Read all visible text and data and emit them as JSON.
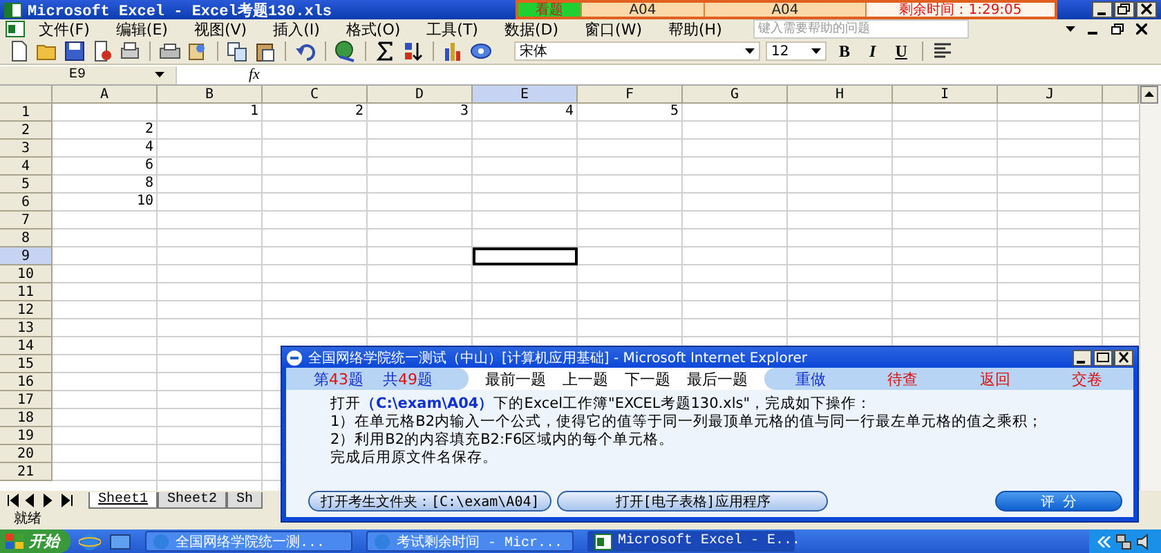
{
  "window": {
    "title": "Microsoft Excel - Excel考题130.xls"
  },
  "exam_timer": {
    "view_button": "看题",
    "field_1": "A04",
    "field_2": "A04",
    "time_left": "剩余时间：1:29:05"
  },
  "menu": [
    "文件(F)",
    "编辑(E)",
    "视图(V)",
    "插入(I)",
    "格式(O)",
    "工具(T)",
    "数据(D)",
    "窗口(W)",
    "帮助(H)"
  ],
  "help_search": {
    "placeholder": "键入需要帮助的问题"
  },
  "format_toolbar": {
    "font": "宋体",
    "size": "12",
    "bold": "B",
    "italic": "I",
    "underline": "U"
  },
  "formula_bar": {
    "name_box": "E9",
    "fx": "fx"
  },
  "sheet": {
    "columns": [
      {
        "label": "A",
        "selected": false
      },
      {
        "label": "B",
        "selected": false
      },
      {
        "label": "C",
        "selected": false
      },
      {
        "label": "D",
        "selected": false
      },
      {
        "label": "E",
        "selected": true
      },
      {
        "label": "F",
        "selected": false
      },
      {
        "label": "G",
        "selected": false
      },
      {
        "label": "H",
        "selected": false
      },
      {
        "label": "I",
        "selected": false
      },
      {
        "label": "J",
        "selected": false
      }
    ],
    "rows": [
      {
        "label": "1",
        "selected": false,
        "cells": {
          "B": "1",
          "C": "2",
          "D": "3",
          "E": "4",
          "F": "5"
        }
      },
      {
        "label": "2",
        "selected": false,
        "cells": {
          "A": "2"
        }
      },
      {
        "label": "3",
        "selected": false,
        "cells": {
          "A": "4"
        }
      },
      {
        "label": "4",
        "selected": false,
        "cells": {
          "A": "6"
        }
      },
      {
        "label": "5",
        "selected": false,
        "cells": {
          "A": "8"
        }
      },
      {
        "label": "6",
        "selected": false,
        "cells": {
          "A": "10"
        }
      },
      {
        "label": "7",
        "selected": false,
        "cells": {}
      },
      {
        "label": "8",
        "selected": false,
        "cells": {}
      },
      {
        "label": "9",
        "selected": true,
        "cells": {}
      },
      {
        "label": "10",
        "selected": false,
        "cells": {}
      },
      {
        "label": "11",
        "selected": false,
        "cells": {}
      },
      {
        "label": "12",
        "selected": false,
        "cells": {}
      },
      {
        "label": "13",
        "selected": false,
        "cells": {}
      },
      {
        "label": "14",
        "selected": false,
        "cells": {}
      },
      {
        "label": "15",
        "selected": false,
        "cells": {}
      },
      {
        "label": "16",
        "selected": false,
        "cells": {}
      },
      {
        "label": "17",
        "selected": false,
        "cells": {}
      },
      {
        "label": "18",
        "selected": false,
        "cells": {}
      },
      {
        "label": "19",
        "selected": false,
        "cells": {}
      },
      {
        "label": "20",
        "selected": false,
        "cells": {}
      },
      {
        "label": "21",
        "selected": false,
        "cells": {}
      }
    ]
  },
  "sheet_tabs": [
    {
      "label": "Sheet1",
      "selected": true
    },
    {
      "label": "Sheet2",
      "selected": false
    },
    {
      "label": "Sh",
      "selected": false
    }
  ],
  "status_bar": "就绪",
  "exam_window": {
    "title": "全国网络学院统一测试（中山）[计算机应用基础] - Microsoft Internet Explorer",
    "counters": [
      {
        "prefix": "第",
        "number": "43",
        "suffix": "题"
      },
      {
        "prefix": "共",
        "number": "49",
        "suffix": "题"
      }
    ],
    "nav": [
      "最前一题",
      "上一题",
      "下一题",
      "最后一题"
    ],
    "actions": [
      {
        "label": "重做",
        "color": "#1030d0"
      },
      {
        "label": "待查",
        "color": "#e01010"
      },
      {
        "label": "返回",
        "color": "#e01010"
      },
      {
        "label": "交卷",
        "color": "#e01010"
      }
    ],
    "instructions": [
      "打开**（C:\\exam\\A04）**下的Excel工作簿\"EXCEL考题130.xls\"，完成如下操作：",
      "1）在单元格B2内输入一个公式，使得它的值等于同一列最顶单元格的值与同一行最左单元格的值之乘积；",
      "2）利用B2的内容填充B2:F6区域内的每个单元格。",
      "完成后用原文件名保存。"
    ],
    "buttons": [
      {
        "kind": "folder",
        "label": "打开考生文件夹：[C:\\exam\\A04]"
      },
      {
        "kind": "app",
        "label": "打开[电子表格]应用程序"
      },
      {
        "kind": "grade",
        "label": "评 分"
      }
    ]
  },
  "taskbar": {
    "start": "开始",
    "tasks": [
      {
        "label": "全国网络学院统一测...",
        "selected": false
      },
      {
        "label": "考试剩余时间 - Micr...",
        "selected": false
      },
      {
        "label": "Microsoft Excel - E...",
        "selected": true
      }
    ]
  }
}
